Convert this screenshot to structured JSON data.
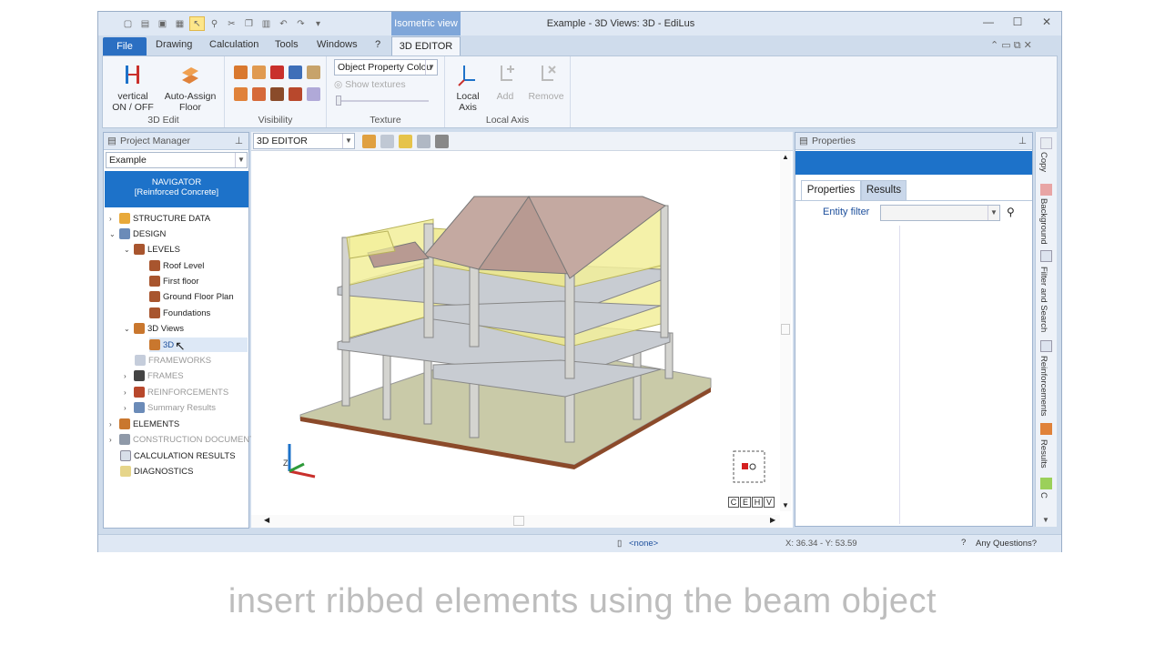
{
  "window": {
    "title": "Example - 3D Views: 3D - EdiLus",
    "context_tab": "Isometric view"
  },
  "menu": {
    "file": "File",
    "items": [
      "Drawing",
      "Calculation",
      "Tools",
      "Windows",
      "?"
    ],
    "active_tab": "3D EDITOR"
  },
  "ribbon": {
    "edit": {
      "vertical": "vertical",
      "onoff": "ON / OFF",
      "auto1": "Auto-Assign",
      "auto2": "Floor",
      "label": "3D Edit"
    },
    "visibility": {
      "label": "Visibility"
    },
    "texture": {
      "combo": "Object Property Colou",
      "show_textures": "Show textures",
      "label": "Texture"
    },
    "local_axis": {
      "local1": "Local",
      "local2": "Axis",
      "add": "Add",
      "remove": "Remove",
      "label": "Local Axis"
    }
  },
  "project_manager": {
    "title": "Project Manager",
    "select": "Example",
    "navigator1": "NAVIGATOR",
    "navigator2": "[Reinforced Concrete]",
    "tree": [
      {
        "label": "STRUCTURE DATA"
      },
      {
        "label": "DESIGN"
      },
      {
        "label": "LEVELS"
      },
      {
        "label": "Roof Level"
      },
      {
        "label": "First floor"
      },
      {
        "label": "Ground Floor Plan"
      },
      {
        "label": "Foundations"
      },
      {
        "label": "3D Views"
      },
      {
        "label": "3D"
      },
      {
        "label": "FRAMEWORKS"
      },
      {
        "label": "FRAMES"
      },
      {
        "label": "REINFORCEMENTS"
      },
      {
        "label": "Summary Results"
      },
      {
        "label": "ELEMENTS"
      },
      {
        "label": "CONSTRUCTION DOCUMENTS"
      },
      {
        "label": "CALCULATION RESULTS"
      },
      {
        "label": "DIAGNOSTICS"
      }
    ]
  },
  "viewport": {
    "combo": "3D EDITOR",
    "view_buttons": [
      "C",
      "E",
      "H",
      "V"
    ],
    "axis_z": "Z"
  },
  "properties": {
    "title": "Properties",
    "tab_properties": "Properties",
    "tab_results": "Results",
    "entity_filter": "Entity filter"
  },
  "right_sidebar": [
    "Copy",
    "Background",
    "Filter and Search",
    "Reinforcements",
    "Results",
    "C"
  ],
  "status": {
    "none": "<none>",
    "coords": "X: 36.34 - Y: 53.59",
    "questions": "Any Questions?"
  },
  "caption": "insert ribbed elements using the beam object",
  "colors": {
    "accent": "#1d72c9",
    "slab": "#f2ef9a",
    "roof": "#c4a9a1"
  }
}
